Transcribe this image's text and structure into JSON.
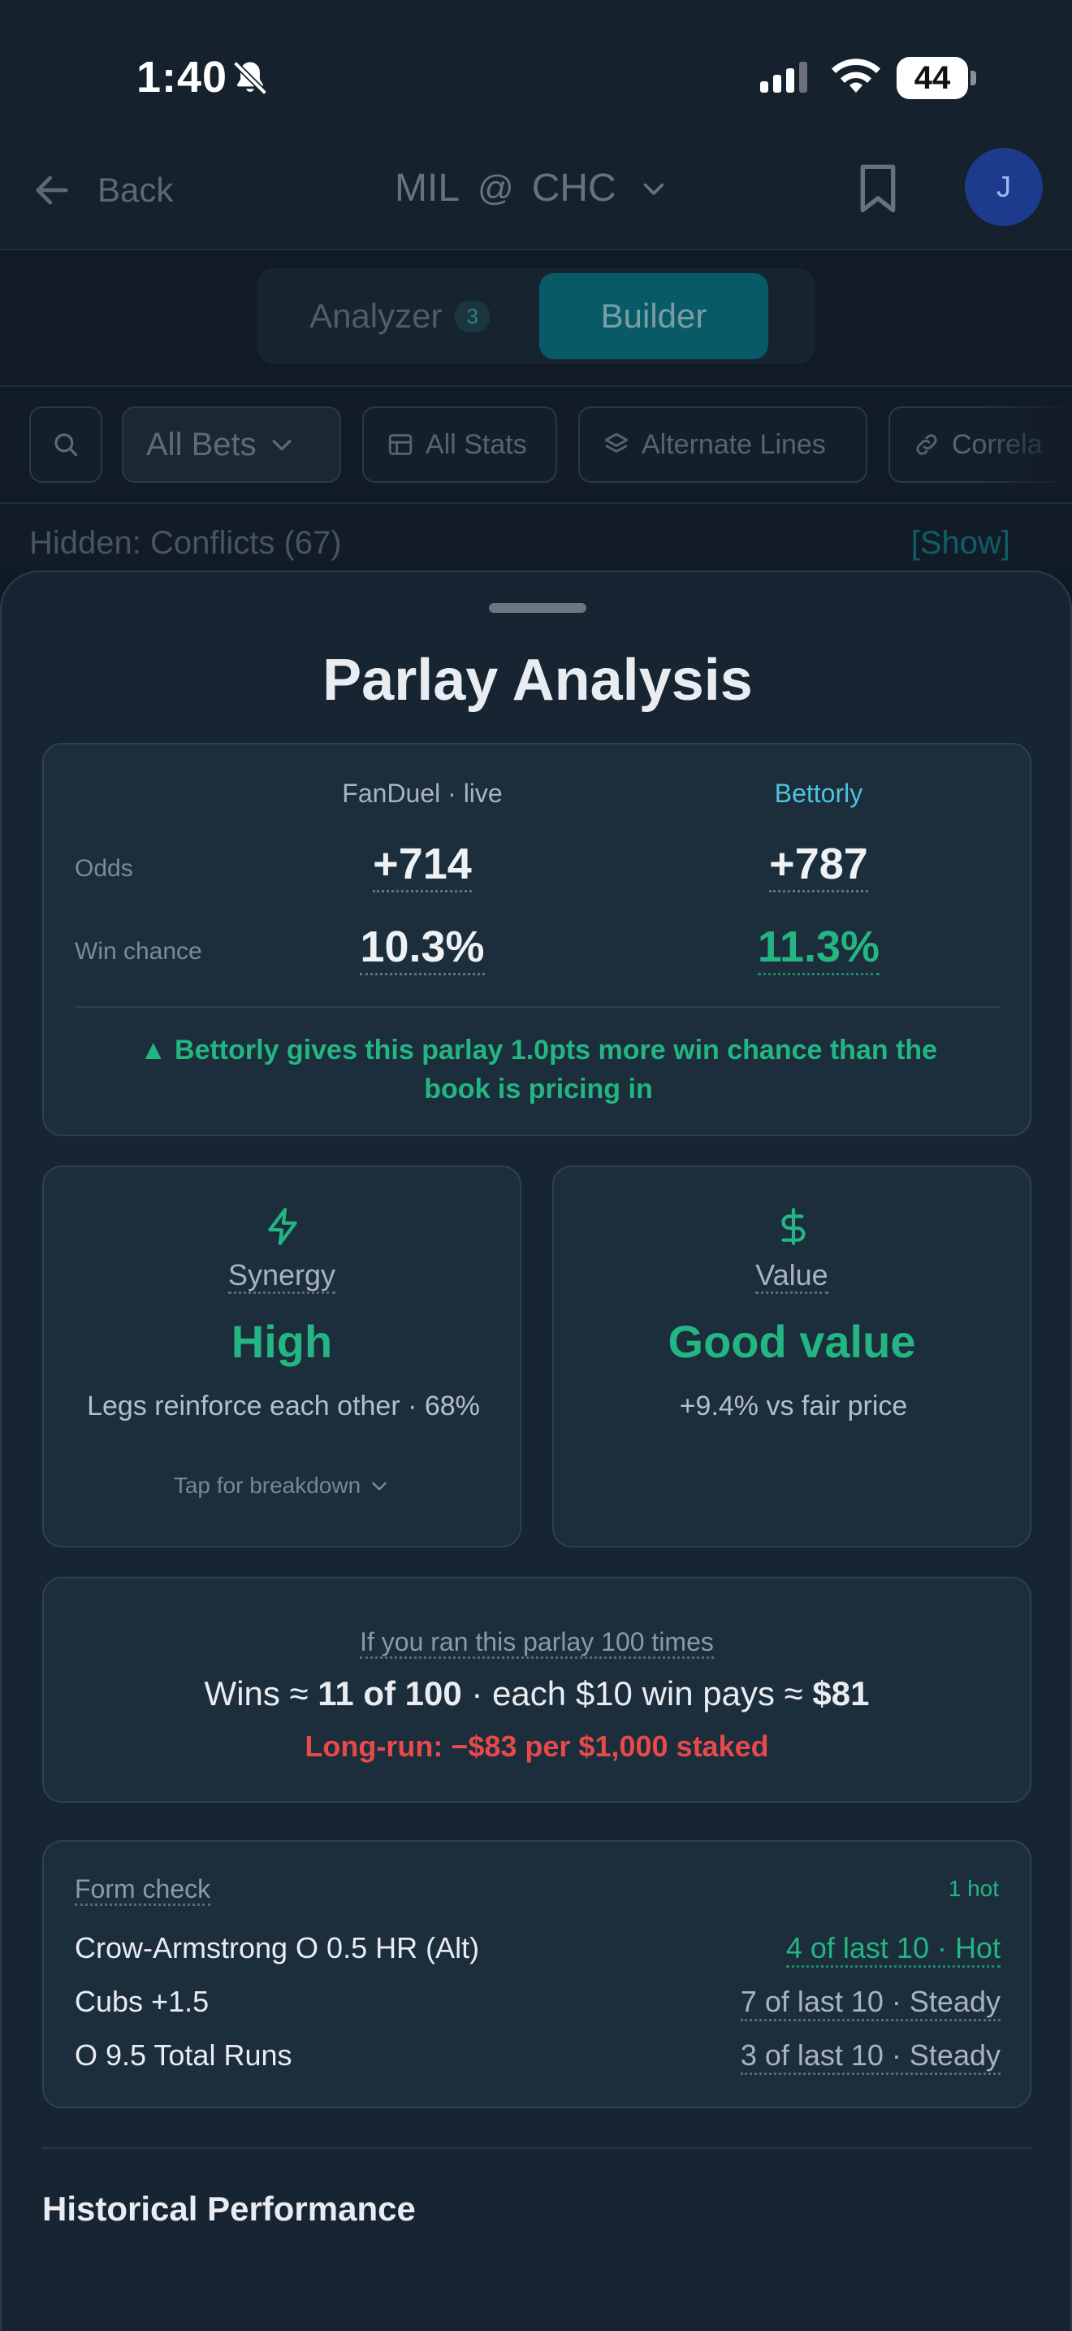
{
  "status_bar": {
    "time": "1:40",
    "battery": "44"
  },
  "nav": {
    "back_label": "Back",
    "away_team": "MIL",
    "at_symbol": "@",
    "home_team": "CHC",
    "avatar_initial": "J"
  },
  "tabs": {
    "analyzer_label": "Analyzer",
    "analyzer_count": "3",
    "builder_label": "Builder",
    "active": "Builder"
  },
  "filters": {
    "all_bets": "All Bets",
    "all_stats": "All Stats",
    "alternate_lines": "Alternate Lines",
    "correlated": "Correla"
  },
  "hidden": {
    "label": "Hidden: Conflicts (67)",
    "show_link": "[Show]"
  },
  "sheet": {
    "title": "Parlay Analysis",
    "odds": {
      "book_header": "FanDuel · live",
      "model_header": "Bettorly",
      "odds_label": "Odds",
      "win_label": "Win chance",
      "book_odds": "+714",
      "model_odds": "+787",
      "book_win": "10.3%",
      "model_win": "11.3%",
      "note": "▲ Bettorly gives this parlay 1.0pts more win chance than the book is pricing in"
    },
    "synergy": {
      "label": "Synergy",
      "value": "High",
      "desc": "Legs reinforce each other · 68%",
      "tap": "Tap for breakdown"
    },
    "value": {
      "label": "Value",
      "value": "Good value",
      "desc": "+9.4% vs fair price"
    },
    "simulation": {
      "header": "If you ran this parlay 100 times",
      "wins_prefix": "Wins ≈ ",
      "wins_value": "11 of 100",
      "pays_text": " · each $10 win pays ≈ ",
      "pays_value": "$81",
      "long_run": "Long-run: −$83 per $1,000 staked"
    },
    "form": {
      "header": "Form check",
      "hot_count": "1 hot",
      "rows": [
        {
          "leg": "Crow-Armstrong O 0.5 HR (Alt)",
          "record": "4 of last 10 · Hot"
        },
        {
          "leg": "Cubs +1.5",
          "record": "7 of last 10 · Steady"
        },
        {
          "leg": "O 9.5 Total Runs",
          "record": "3 of last 10 · Steady"
        }
      ]
    },
    "historical_title": "Historical Performance"
  },
  "colors": {
    "accent_green": "#23b682",
    "accent_cyan": "#4fc3dc",
    "loss_red": "#e64a4a",
    "builder_tab": "#085b66"
  }
}
